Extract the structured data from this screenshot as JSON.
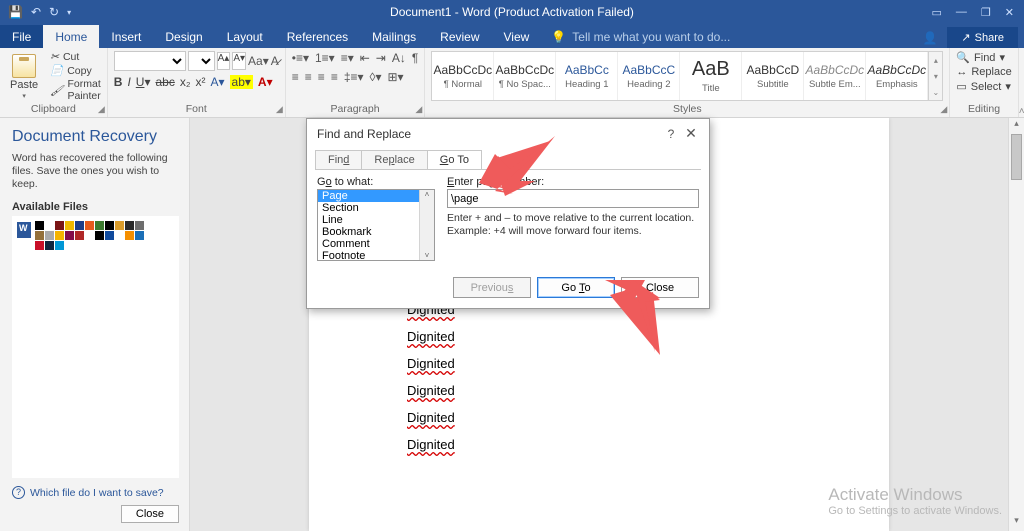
{
  "titlebar": {
    "title": "Document1 - Word (Product Activation Failed)"
  },
  "ribtabs": {
    "file": "File",
    "home": "Home",
    "insert": "Insert",
    "design": "Design",
    "layout": "Layout",
    "references": "References",
    "mailings": "Mailings",
    "review": "Review",
    "view": "View",
    "tellme_placeholder": "Tell me what you want to do...",
    "share": "Share"
  },
  "ribbon": {
    "clipboard": {
      "paste": "Paste",
      "cut": "Cut",
      "copy": "Copy",
      "painter": "Format Painter",
      "label": "Clipboard"
    },
    "font": {
      "family": "",
      "size": "",
      "label": "Font"
    },
    "paragraph": {
      "label": "Paragraph"
    },
    "styles": {
      "label": "Styles",
      "items": [
        {
          "preview": "AaBbCcDc",
          "name": "¶ Normal"
        },
        {
          "preview": "AaBbCcDc",
          "name": "¶ No Spac..."
        },
        {
          "preview": "AaBbCc",
          "name": "Heading 1"
        },
        {
          "preview": "AaBbCcC",
          "name": "Heading 2"
        },
        {
          "preview": "AaB",
          "name": "Title"
        },
        {
          "preview": "AaBbCcD",
          "name": "Subtitle"
        },
        {
          "preview": "AaBbCcDc",
          "name": "Subtle Em..."
        },
        {
          "preview": "AaBbCcDc",
          "name": "Emphasis"
        }
      ]
    },
    "editing": {
      "find": "Find",
      "replace": "Replace",
      "select": "Select",
      "label": "Editing"
    }
  },
  "recovery": {
    "title": "Document Recovery",
    "msg": "Word has recovered the following files. Save the ones you wish to keep.",
    "avail": "Available Files",
    "which": "Which file do I want to save?",
    "close": "Close",
    "swatch_colors": [
      "#000",
      "#fff",
      "#7a1415",
      "#f0b800",
      "#1d3e89",
      "#e55a1e",
      "#3b7a2e",
      "#000",
      "#da9c2a",
      "#2a2a2a",
      "#6e6e6e",
      "#94703a",
      "#aaa",
      "#f5b400",
      "#840c4a",
      "#b02727",
      "#fff",
      "#000",
      "#0f4a9d",
      "#fff",
      "#f58f00",
      "#1b6fb7",
      "#c80f28",
      "#10243e",
      "#0097d6",
      "#fff"
    ]
  },
  "document": {
    "word": "Dignited",
    "count": 8
  },
  "dialog": {
    "title": "Find and Replace",
    "tabs": {
      "find": "Find",
      "replace": "Replace",
      "goto": "Go To"
    },
    "gotowhat": "Go to what:",
    "items": [
      "Page",
      "Section",
      "Line",
      "Bookmark",
      "Comment",
      "Footnote"
    ],
    "enter_label": "Enter page number:",
    "input_value": "\\page",
    "hint": "Enter + and – to move relative to the current location. Example: +4 will move forward four items.",
    "btn_prev": "Previous",
    "btn_goto": "Go To",
    "btn_close": "Close"
  },
  "watermark": {
    "l1": "Activate Windows",
    "l2": "Go to Settings to activate Windows."
  }
}
